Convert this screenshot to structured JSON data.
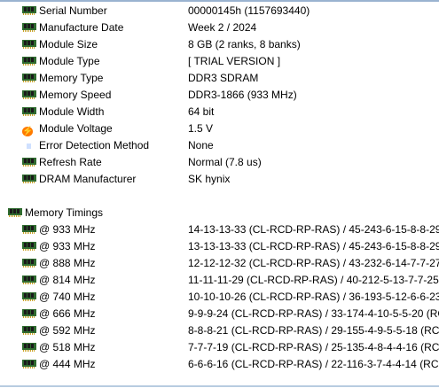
{
  "module": {
    "rows": [
      {
        "label": "Serial Number",
        "value": "00000145h (1157693440)",
        "icon": "memory-module-icon"
      },
      {
        "label": "Manufacture Date",
        "value": "Week 2 / 2024",
        "icon": "memory-module-icon"
      },
      {
        "label": "Module Size",
        "value": "8 GB (2 ranks, 8 banks)",
        "icon": "memory-module-icon"
      },
      {
        "label": "Module Type",
        "value": "[ TRIAL VERSION ]",
        "icon": "memory-module-icon"
      },
      {
        "label": "Memory Type",
        "value": "DDR3 SDRAM",
        "icon": "memory-module-icon"
      },
      {
        "label": "Memory Speed",
        "value": "DDR3-1866 (933 MHz)",
        "icon": "memory-module-icon"
      },
      {
        "label": "Module Width",
        "value": "64 bit",
        "icon": "memory-module-icon"
      },
      {
        "label": "Module Voltage",
        "value": "1.5 V",
        "icon": "voltage-icon"
      },
      {
        "label": "Error Detection Method",
        "value": "None",
        "icon": "error-detection-icon"
      },
      {
        "label": "Refresh Rate",
        "value": "Normal (7.8 us)",
        "icon": "memory-module-icon"
      },
      {
        "label": "DRAM Manufacturer",
        "value": "SK hynix",
        "icon": "memory-module-icon"
      }
    ]
  },
  "timings": {
    "header": "Memory Timings",
    "rows": [
      {
        "label": "@ 933 MHz",
        "value": "14-13-13-33  (CL-RCD-RP-RAS) / 45-243-6-15-8-8-29"
      },
      {
        "label": "@ 933 MHz",
        "value": "13-13-13-33  (CL-RCD-RP-RAS) / 45-243-6-15-8-8-29"
      },
      {
        "label": "@ 888 MHz",
        "value": "12-12-12-32  (CL-RCD-RP-RAS) / 43-232-6-14-7-7-27"
      },
      {
        "label": "@ 814 MHz",
        "value": "11-11-11-29  (CL-RCD-RP-RAS) / 40-212-5-13-7-7-25"
      },
      {
        "label": "@ 740 MHz",
        "value": "10-10-10-26  (CL-RCD-RP-RAS) / 36-193-5-12-6-6-23"
      },
      {
        "label": "@ 666 MHz",
        "value": "9-9-9-24  (CL-RCD-RP-RAS) / 33-174-4-10-5-5-20  (RC"
      },
      {
        "label": "@ 592 MHz",
        "value": "8-8-8-21  (CL-RCD-RP-RAS) / 29-155-4-9-5-5-18  (RC-"
      },
      {
        "label": "@ 518 MHz",
        "value": "7-7-7-19  (CL-RCD-RP-RAS) / 25-135-4-8-4-4-16  (RC-"
      },
      {
        "label": "@ 444 MHz",
        "value": "6-6-6-16  (CL-RCD-RP-RAS) / 22-116-3-7-4-4-14  (RC-"
      }
    ]
  }
}
